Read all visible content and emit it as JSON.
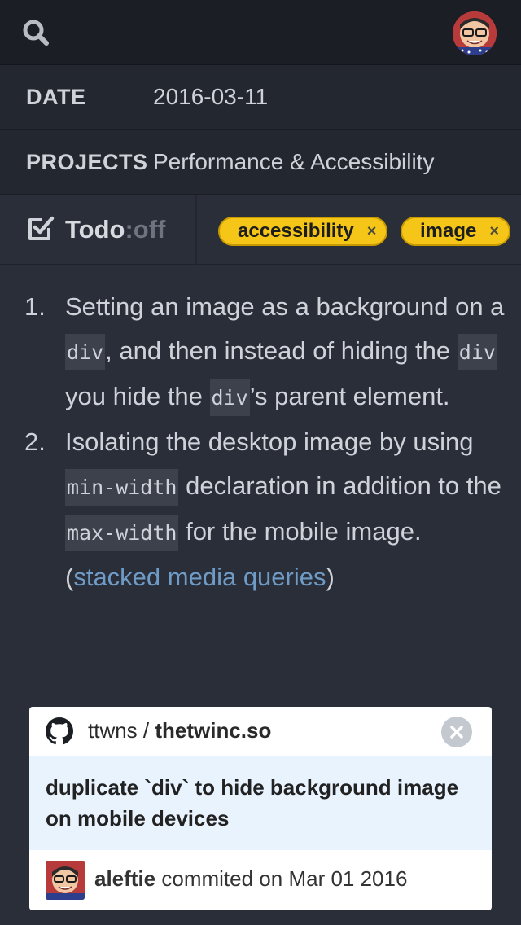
{
  "header": {
    "search_icon": "search-icon",
    "avatar_icon": "user-avatar"
  },
  "meta": {
    "date_label": "DATE",
    "date_value": "2016-03-11",
    "projects_label": "PROJECTS",
    "projects_value": "Performance & Accessibility"
  },
  "todo": {
    "label": "Todo",
    "colon": ":",
    "state": "off",
    "icon": "checkbox-icon"
  },
  "tags": [
    {
      "label": "accessibility",
      "remove": "×"
    },
    {
      "label": "image",
      "remove": "×"
    }
  ],
  "notes": {
    "item1": {
      "num": "1.",
      "t1": "Setting an image as a background on a ",
      "c1": "div",
      "t2": ", and then instead of hiding the ",
      "c2": "div",
      "t3": " you hide the ",
      "c3": "div",
      "t4": "’s parent element."
    },
    "item2": {
      "num": "2.",
      "t1": "Isolating the desktop image by using ",
      "c1": "min-width",
      "t2": " declaration in addition to the ",
      "c2": "max-width",
      "t3": " for the mobile image. (",
      "link": "stacked media queries",
      "t4": ")"
    }
  },
  "commit_card": {
    "owner": "ttwns",
    "separator": " / ",
    "repo": "thetwinc.so",
    "message": "duplicate `div` to hide background image on mobile devices",
    "author": "aleftie",
    "action": " commited on ",
    "date": "Mar 01 2016",
    "colors": {
      "body_bg": "#e8f3fe",
      "close_bg": "#c4c8cf"
    }
  },
  "colors": {
    "page_bg": "#2a2e38",
    "topbar_bg": "#1b1e24",
    "tag_bg": "#f5c518",
    "link": "#6f9bc7"
  }
}
